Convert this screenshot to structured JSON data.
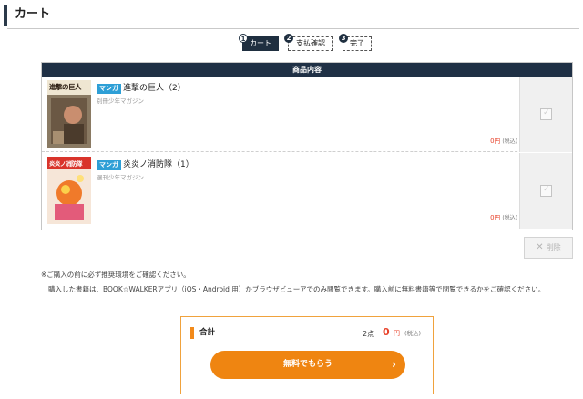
{
  "header": {
    "title": "カート"
  },
  "steps": [
    {
      "number": "1",
      "label": "カート",
      "state": "active"
    },
    {
      "number": "2",
      "label": "支払確認",
      "state": "pending"
    },
    {
      "number": "3",
      "label": "完了",
      "state": "pending"
    }
  ],
  "cart": {
    "header_label": "商品内容",
    "items": [
      {
        "badge": "マンガ",
        "title": "進撃の巨人（2）",
        "publisher": "別冊少年マガジン",
        "price": "0",
        "currency": "円",
        "tax_note": "(税込)",
        "cover_text": "進撃の巨人",
        "checked": false
      },
      {
        "badge": "マンガ",
        "title": "炎炎ノ消防隊（1）",
        "publisher": "週刊少年マガジン",
        "price": "0",
        "currency": "円",
        "tax_note": "(税込)",
        "cover_text": "炎炎ノ消防隊",
        "checked": false
      }
    ],
    "delete_label": "削除"
  },
  "notice": {
    "line1": "※ご購入の前に必ず推奨環境をご確認ください。",
    "line2": "購入した書籍は、BOOK☆WALKERアプリ（iOS・Android 用）かブラウザビューアでのみ閲覧できます。購入前に無料書籍等で閲覧できるかをご確認ください。"
  },
  "summary": {
    "label": "合計",
    "count": "2点",
    "amount": "0",
    "currency": "円",
    "tax_note": "(税込)",
    "cta_label": "無料でもらう"
  },
  "colors": {
    "navy": "#1f3045",
    "accent_orange": "#ef8511",
    "price_red": "#e8422a",
    "badge_blue": "#2e9fd6"
  }
}
